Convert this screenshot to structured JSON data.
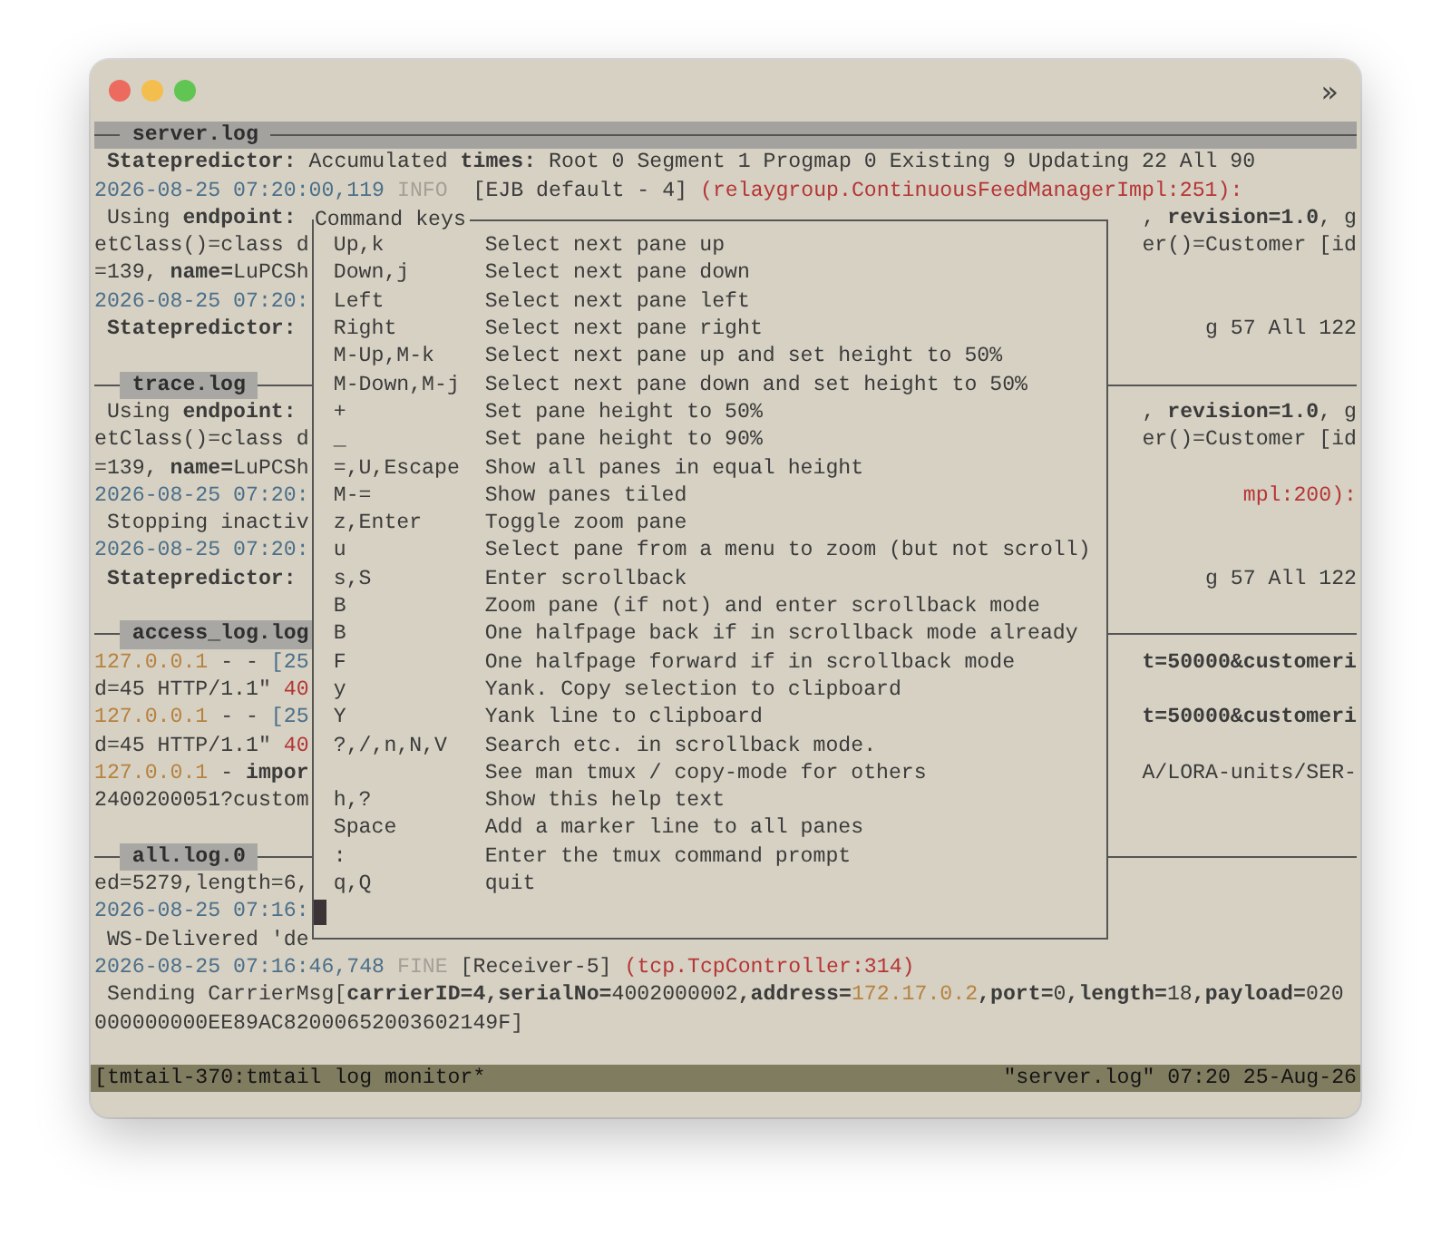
{
  "window": {
    "toolbar_glyph": "»"
  },
  "panes": [
    {
      "title": "server.log",
      "active": true,
      "lines": [
        {
          "kind": "text",
          "left": [
            {
              "text": " Statepredictor:",
              "kind": "bold"
            },
            {
              "text": " Accumulated ",
              "kind": "plain"
            },
            {
              "text": "times:",
              "kind": "bold"
            },
            {
              "text": " Root 0 Segment 1 Progmap 0 Existing 9 Updating 22 All 90",
              "kind": "plain"
            }
          ]
        },
        {
          "kind": "text",
          "left": [
            {
              "text": "2026-08-25 07:20:00,119",
              "kind": "time"
            },
            {
              "text": " INFO ",
              "kind": "level"
            },
            {
              "text": " [EJB default - 4] ",
              "kind": "plain"
            },
            {
              "text": "(relaygroup.ContinuousFeedManagerImpl:251):",
              "kind": "error"
            }
          ]
        },
        {
          "kind": "text",
          "left": [
            {
              "text": " Using ",
              "kind": "plain"
            },
            {
              "text": "endpoint:",
              "kind": "bold"
            }
          ],
          "right": [
            {
              "text": ", ",
              "kind": "plain"
            },
            {
              "text": "revision=1.0",
              "kind": "bold"
            },
            {
              "text": ", g",
              "kind": "plain"
            }
          ]
        },
        {
          "kind": "text",
          "left": [
            {
              "text": "etClass()=class d",
              "kind": "plain"
            }
          ],
          "right": [
            {
              "text": "er()=Customer [id",
              "kind": "plain"
            }
          ]
        },
        {
          "kind": "text",
          "left": [
            {
              "text": "=139, ",
              "kind": "plain"
            },
            {
              "text": "name=",
              "kind": "bold"
            },
            {
              "text": "LuPCSh",
              "kind": "plain"
            }
          ]
        },
        {
          "kind": "text",
          "left": [
            {
              "text": "2026-08-25 07:20:",
              "kind": "time"
            }
          ]
        },
        {
          "kind": "text",
          "left": [
            {
              "text": " Statepredictor:",
              "kind": "bold"
            }
          ],
          "right": [
            {
              "text": "g 57 All 122",
              "kind": "plain"
            }
          ]
        },
        {
          "kind": "blank"
        }
      ]
    },
    {
      "title": "trace.log",
      "active": false,
      "lines": [
        {
          "kind": "text",
          "left": [
            {
              "text": " Using ",
              "kind": "plain"
            },
            {
              "text": "endpoint:",
              "kind": "bold"
            }
          ],
          "right": [
            {
              "text": ", ",
              "kind": "plain"
            },
            {
              "text": "revision=1.0",
              "kind": "bold"
            },
            {
              "text": ", g",
              "kind": "plain"
            }
          ]
        },
        {
          "kind": "text",
          "left": [
            {
              "text": "etClass()=class d",
              "kind": "plain"
            }
          ],
          "right": [
            {
              "text": "er()=Customer [id",
              "kind": "plain"
            }
          ]
        },
        {
          "kind": "text",
          "left": [
            {
              "text": "=139, ",
              "kind": "plain"
            },
            {
              "text": "name=",
              "kind": "bold"
            },
            {
              "text": "LuPCSh",
              "kind": "plain"
            }
          ]
        },
        {
          "kind": "text",
          "left": [
            {
              "text": "2026-08-25 07:20:",
              "kind": "time"
            }
          ],
          "right": [
            {
              "text": "mpl:200):",
              "kind": "error"
            }
          ]
        },
        {
          "kind": "text",
          "left": [
            {
              "text": " Stopping inactiv",
              "kind": "plain"
            }
          ]
        },
        {
          "kind": "text",
          "left": [
            {
              "text": "2026-08-25 07:20:",
              "kind": "time"
            }
          ]
        },
        {
          "kind": "text",
          "left": [
            {
              "text": " Statepredictor:",
              "kind": "bold"
            }
          ],
          "right": [
            {
              "text": "g 57 All 122",
              "kind": "plain"
            }
          ]
        },
        {
          "kind": "blank"
        }
      ]
    },
    {
      "title": "access_log.log",
      "active": false,
      "lines": [
        {
          "kind": "text",
          "left": [
            {
              "text": "127.0.0.1",
              "kind": "ip"
            },
            {
              "text": " - - ",
              "kind": "plain"
            },
            {
              "text": "[25",
              "kind": "time"
            }
          ],
          "right": [
            {
              "text": "t=50000&customeri",
              "kind": "bold"
            }
          ]
        },
        {
          "kind": "text",
          "left": [
            {
              "text": "d=45 HTTP/1.1\" ",
              "kind": "plain"
            },
            {
              "text": "40",
              "kind": "error"
            }
          ]
        },
        {
          "kind": "text",
          "left": [
            {
              "text": "127.0.0.1",
              "kind": "ip"
            },
            {
              "text": " - - ",
              "kind": "plain"
            },
            {
              "text": "[25",
              "kind": "time"
            }
          ],
          "right": [
            {
              "text": "t=50000&customeri",
              "kind": "bold"
            }
          ]
        },
        {
          "kind": "text",
          "left": [
            {
              "text": "d=45 HTTP/1.1\" ",
              "kind": "plain"
            },
            {
              "text": "40",
              "kind": "error"
            }
          ]
        },
        {
          "kind": "text",
          "left": [
            {
              "text": "127.0.0.1",
              "kind": "ip"
            },
            {
              "text": " - ",
              "kind": "plain"
            },
            {
              "text": "impor",
              "kind": "bold"
            }
          ],
          "right": [
            {
              "text": "A/LORA-units/SER-",
              "kind": "plain"
            }
          ]
        },
        {
          "kind": "text",
          "left": [
            {
              "text": "2400200051?custom",
              "kind": "plain"
            }
          ]
        },
        {
          "kind": "blank"
        }
      ]
    },
    {
      "title": "all.log.0",
      "active": false,
      "lines": [
        {
          "kind": "text",
          "left": [
            {
              "text": "ed=5279,length=6,",
              "kind": "plain"
            }
          ]
        },
        {
          "kind": "text",
          "left": [
            {
              "text": "2026-08-25 07:16:",
              "kind": "time"
            }
          ]
        },
        {
          "kind": "text",
          "left": [
            {
              "text": " WS-Delivered 'de",
              "kind": "plain"
            }
          ]
        },
        {
          "kind": "text",
          "left": [
            {
              "text": "2026-08-25 07:16:46,748",
              "kind": "time"
            },
            {
              "text": " FINE ",
              "kind": "level"
            },
            {
              "text": "[Receiver-5] ",
              "kind": "plain"
            },
            {
              "text": "(tcp.TcpController:314)",
              "kind": "error"
            }
          ]
        },
        {
          "kind": "text",
          "left": [
            {
              "text": " Sending CarrierMsg[",
              "kind": "plain"
            },
            {
              "text": "carrierID=4,serialNo=",
              "kind": "bold"
            },
            {
              "text": "4002000002",
              "kind": "plain"
            },
            {
              "text": ",address=",
              "kind": "bold"
            },
            {
              "text": "172.17.0.2",
              "kind": "ip"
            },
            {
              "text": ",port=",
              "kind": "bold"
            },
            {
              "text": "0",
              "kind": "plain"
            },
            {
              "text": ",length=",
              "kind": "bold"
            },
            {
              "text": "18",
              "kind": "plain"
            },
            {
              "text": ",payload=",
              "kind": "bold"
            },
            {
              "text": "020",
              "kind": "plain"
            }
          ]
        },
        {
          "kind": "text",
          "left": [
            {
              "text": "000000000EE89AC82000652003602149F]",
              "kind": "plain"
            }
          ]
        }
      ]
    }
  ],
  "popup": {
    "title": "Command keys",
    "cursor_visible": true,
    "entries": [
      {
        "keys": "Up,k",
        "description": "Select next pane up"
      },
      {
        "keys": "Down,j",
        "description": "Select next pane down"
      },
      {
        "keys": "Left",
        "description": "Select next pane left"
      },
      {
        "keys": "Right",
        "description": "Select next pane right"
      },
      {
        "keys": "M-Up,M-k",
        "description": "Select next pane up and set height to 50%"
      },
      {
        "keys": "M-Down,M-j",
        "description": "Select next pane down and set height to 50%"
      },
      {
        "keys": "+",
        "description": "Set pane height to 50%"
      },
      {
        "keys": "_",
        "description": "Set pane height to 90%"
      },
      {
        "keys": "=,U,Escape",
        "description": "Show all panes in equal height"
      },
      {
        "keys": "M-=",
        "description": "Show panes tiled"
      },
      {
        "keys": "z,Enter",
        "description": "Toggle zoom pane"
      },
      {
        "keys": "u",
        "description": "Select pane from a menu to zoom (but not scroll)"
      },
      {
        "keys": "s,S",
        "description": "Enter scrollback"
      },
      {
        "keys": "B",
        "description": "Zoom pane (if not) and enter scrollback mode"
      },
      {
        "keys": "B",
        "description": "One halfpage back if in scrollback mode already"
      },
      {
        "keys": "F",
        "description": "One halfpage forward if in scrollback mode"
      },
      {
        "keys": "y",
        "description": "Yank. Copy selection to clipboard"
      },
      {
        "keys": "Y",
        "description": "Yank line to clipboard"
      },
      {
        "keys": "?,/,n,N,V",
        "description": "Search etc. in scrollback mode."
      },
      {
        "description": "See man tmux / copy-mode for others"
      },
      {
        "keys": "h,?",
        "description": "Show this help text"
      },
      {
        "keys": "Space",
        "description": "Add a marker line to all panes"
      },
      {
        "keys": ":",
        "description": "Enter the tmux command prompt"
      },
      {
        "keys": "q,Q",
        "description": "quit"
      }
    ]
  },
  "status_bar": {
    "left": "[tmtail-370:tmtail log monitor*",
    "right": "\"server.log\" 07:20 25-Aug-26"
  }
}
